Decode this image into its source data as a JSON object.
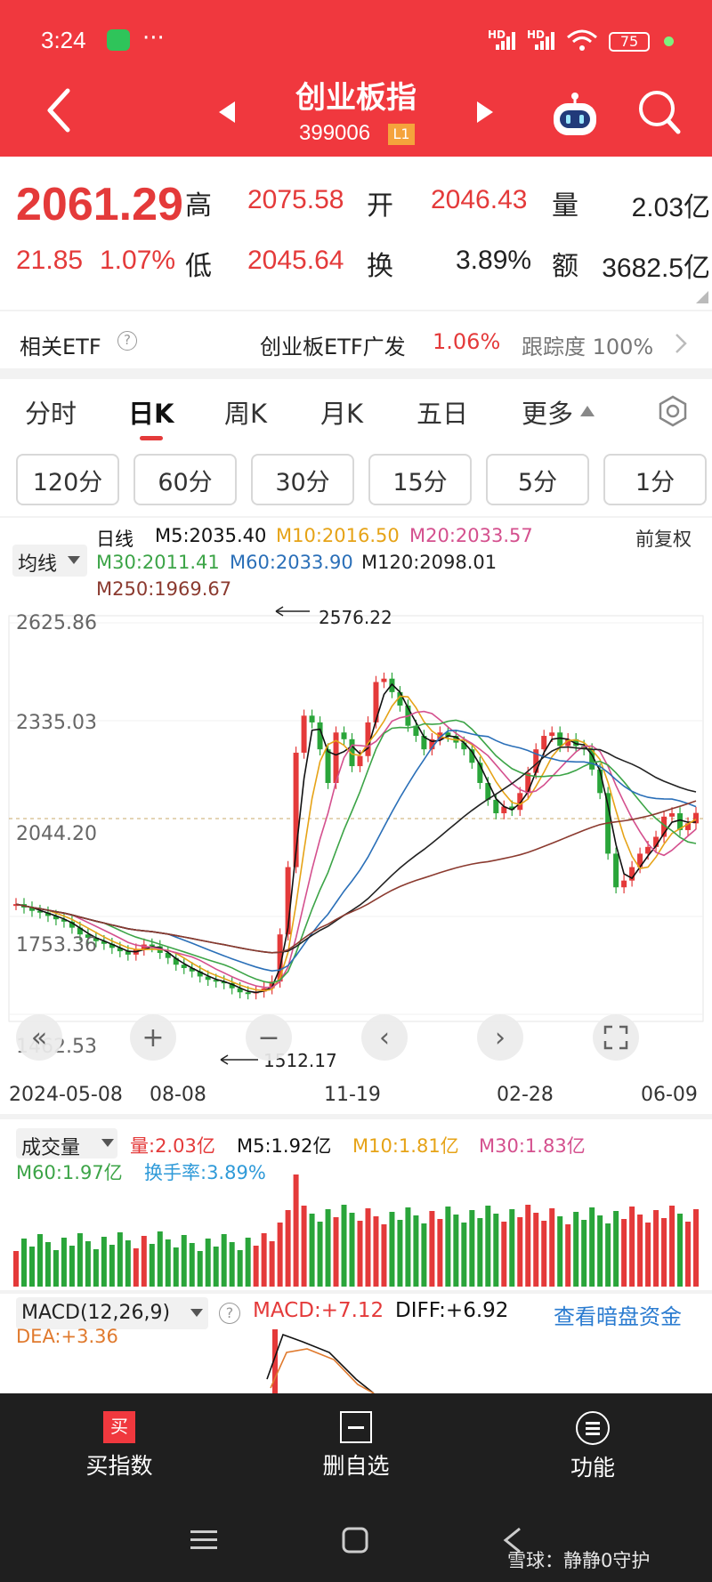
{
  "status_bar": {
    "time": "3:24",
    "dots": "···",
    "battery": "75",
    "hd1": "HD",
    "hd2": "HD"
  },
  "header": {
    "title": "创业板指",
    "code": "399006",
    "level_badge": "L1"
  },
  "quote": {
    "price": "2061.29",
    "change": "21.85",
    "change_pct": "1.07%",
    "high_label": "高",
    "high": "2075.58",
    "low_label": "低",
    "low": "2045.64",
    "open_label": "开",
    "open": "2046.43",
    "turnover_label": "换",
    "turnover": "3.89%",
    "volume_label": "量",
    "volume": "2.03亿",
    "amount_label": "额",
    "amount": "3682.5亿"
  },
  "etf": {
    "label": "相关ETF",
    "help": "?",
    "name": "创业板ETF广发",
    "pct": "1.06%",
    "tracking": "跟踪度 100%"
  },
  "tabs": [
    "分时",
    "日K",
    "周K",
    "月K",
    "五日",
    "更多"
  ],
  "period_buttons": [
    "120分",
    "60分",
    "30分",
    "15分",
    "5分",
    "1分"
  ],
  "chart_header": {
    "ma_selector": "均线",
    "line_type": "日线",
    "fq": "前复权",
    "ma": {
      "m5": "M5:2035.40",
      "m10": "M10:2016.50",
      "m20": "M20:2033.57",
      "m30": "M30:2011.41",
      "m60": "M60:2033.90",
      "m120": "M120:2098.01",
      "m250": "M250:1969.67"
    }
  },
  "colors": {
    "header_red": "#f0383e",
    "up": "#e43a3a",
    "down": "#2aa53a",
    "m5": "#111111",
    "m10": "#e6a317",
    "m20": "#d4508e",
    "m30": "#3ca447",
    "m60": "#2a6fb8",
    "m120": "#222222",
    "m250": "#8b3a2f",
    "turnover_blue": "#2f9ad8"
  },
  "chart_data": [
    {
      "type": "candlestick",
      "y_ticks": [
        "2625.86",
        "2335.03",
        "2044.20",
        "1753.36",
        "1462.53"
      ],
      "ylim": [
        1462.53,
        2625.86
      ],
      "x_ticks": [
        "2024-05-08",
        "08-08",
        "11-19",
        "02-28",
        "06-09"
      ],
      "max_annotation": "2576.22",
      "min_annotation": "1512.17",
      "close_series": [
        1790,
        1780,
        1770,
        1765,
        1755,
        1745,
        1738,
        1720,
        1700,
        1690,
        1680,
        1672,
        1660,
        1650,
        1640,
        1655,
        1670,
        1665,
        1645,
        1630,
        1610,
        1600,
        1590,
        1575,
        1565,
        1560,
        1555,
        1540,
        1528,
        1525,
        1530,
        1540,
        1560,
        1700,
        1900,
        2240,
        2350,
        2330,
        2250,
        2150,
        2300,
        2280,
        2200,
        2230,
        2330,
        2450,
        2460,
        2420,
        2380,
        2320,
        2290,
        2250,
        2280,
        2300,
        2290,
        2270,
        2250,
        2210,
        2150,
        2100,
        2060,
        2080,
        2070,
        2120,
        2180,
        2250,
        2290,
        2300,
        2260,
        2280,
        2260,
        2250,
        2190,
        2120,
        1940,
        1840,
        1860,
        1900,
        1940,
        1960,
        1990,
        2050,
        2060,
        2010,
        2030,
        2061
      ]
    },
    {
      "type": "bar",
      "title": "成交量",
      "selector": "成交量",
      "labels": {
        "vol": "量:2.03亿",
        "m5": "M5:1.92亿",
        "m10": "M10:1.81亿",
        "m30": "M30:1.83亿",
        "m60": "M60:1.97亿",
        "turnover": "换手率:3.89%"
      }
    },
    {
      "type": "bar",
      "title": "MACD(12,26,9)",
      "selector": "MACD(12,26,9)",
      "help": "?",
      "macd": "MACD:+7.12",
      "diff": "DIFF:+6.92",
      "dea": "DEA:+3.36",
      "link": "查看暗盘资金"
    }
  ],
  "bottom_nav": [
    {
      "label": "买指数",
      "badge": "买"
    },
    {
      "label": "删自选"
    },
    {
      "label": "功能"
    }
  ],
  "watermark": "雪球：静静0守护"
}
